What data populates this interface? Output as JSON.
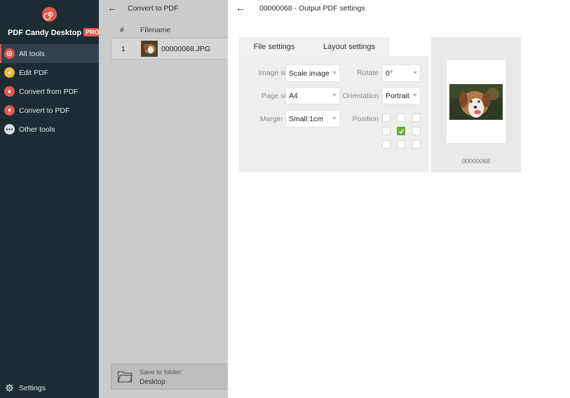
{
  "app": {
    "brand": "PDF Candy Desktop",
    "pro_badge": "PRO"
  },
  "sidebar": {
    "items": [
      {
        "label": "All tools",
        "icon": "all-tools-icon",
        "active": true
      },
      {
        "label": "Edit PDF",
        "icon": "edit-pdf-icon",
        "active": false
      },
      {
        "label": "Convert from PDF",
        "icon": "convert-from-pdf-icon",
        "active": false
      },
      {
        "label": "Convert to PDF",
        "icon": "convert-to-pdf-icon",
        "active": false
      },
      {
        "label": "Other tools",
        "icon": "other-tools-icon",
        "active": false
      }
    ],
    "settings_label": "Settings"
  },
  "convert": {
    "title": "Convert to PDF",
    "columns": [
      "#",
      "Filename"
    ],
    "files": [
      {
        "num": "1",
        "name": "00000068.JPG"
      }
    ],
    "save_label": "Save to folder:",
    "save_value": "Desktop"
  },
  "output": {
    "title": "00000068 - Output PDF settings",
    "tabs": [
      "File settings",
      "Layout settings"
    ],
    "active_tab": "Layout settings",
    "fields": {
      "image_size": {
        "label": "Image size",
        "value": "Scale image"
      },
      "page_size": {
        "label": "Page size",
        "value": "A4"
      },
      "margin": {
        "label": "Margin",
        "value": "Small:1cm"
      },
      "rotate": {
        "label": "Rotate",
        "value": "0°"
      },
      "orientation": {
        "label": "Orientation",
        "value": "Portrait"
      },
      "position": {
        "label": "Position",
        "selected": "center"
      }
    },
    "preview_name": "00000068"
  },
  "colors": {
    "sidebar_bg": "#1f2b33",
    "accent": "#e2574c",
    "check_green": "#6bb330"
  }
}
